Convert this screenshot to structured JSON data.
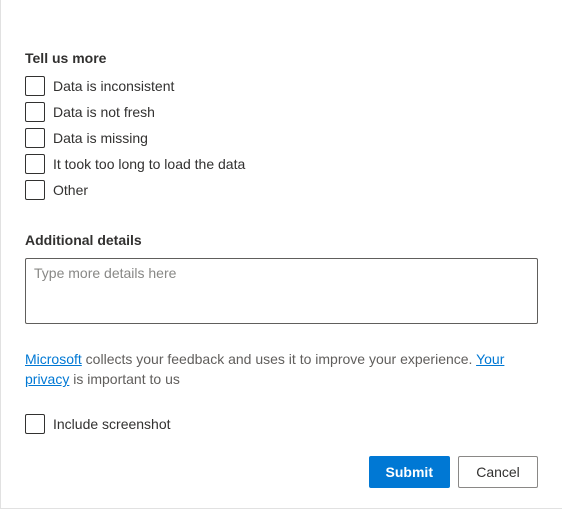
{
  "section1": {
    "title": "Tell us more",
    "options": [
      "Data is inconsistent",
      "Data is not fresh",
      "Data is missing",
      "It took too long to load the data",
      "Other"
    ]
  },
  "section2": {
    "title": "Additional details",
    "placeholder": "Type more details here"
  },
  "info": {
    "link1": "Microsoft",
    "text1": " collects your feedback and uses it to improve your experience. ",
    "link2": "Your privacy",
    "text2": " is important to us"
  },
  "screenshot": {
    "label": "Include screenshot"
  },
  "footer": {
    "submit": "Submit",
    "cancel": "Cancel"
  }
}
